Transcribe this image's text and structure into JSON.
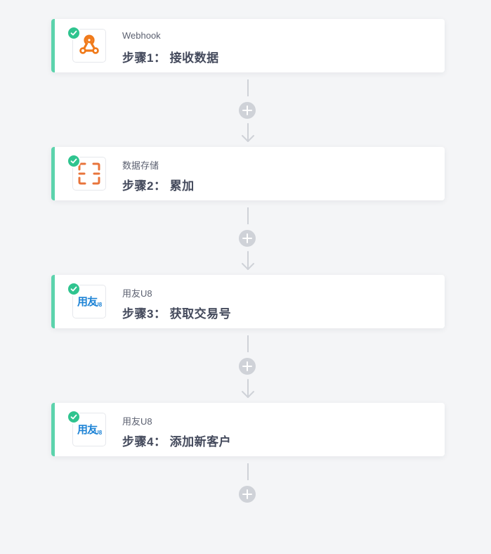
{
  "colors": {
    "accent": "#5cd3ac",
    "check": "#2fc48f",
    "connector": "#cfd2d8",
    "webhook": "#f07a1a",
    "storage": "#e8743b",
    "u8": "#1f84d6"
  },
  "steps": [
    {
      "app": "Webhook",
      "title": "步骤1： 接收数据",
      "icon": "webhook-icon"
    },
    {
      "app": "数据存储",
      "title": "步骤2： 累加",
      "icon": "data-storage-icon"
    },
    {
      "app": "用友U8",
      "title": "步骤3： 获取交易号",
      "icon": "yonyou-u8-logo",
      "logo_main": "用友",
      "logo_sub": "U8"
    },
    {
      "app": "用友U8",
      "title": "步骤4： 添加新客户",
      "icon": "yonyou-u8-logo",
      "logo_main": "用友",
      "logo_sub": "U8"
    }
  ]
}
